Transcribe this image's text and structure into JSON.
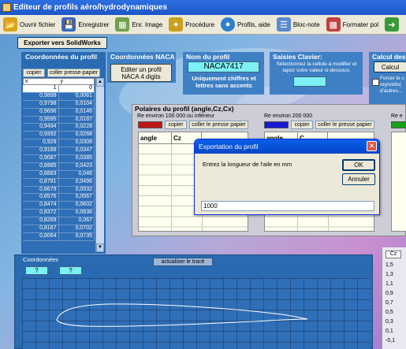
{
  "window": {
    "title": "Editeur de profils aéro/hydrodynamiques"
  },
  "toolbar": [
    {
      "label": "Ouvrir fichier",
      "icon": "folder-open-icon",
      "color": "#d8a21c"
    },
    {
      "label": "Enregistrer",
      "icon": "save-icon",
      "color": "#3a64c4"
    },
    {
      "label": "Enr. Image",
      "icon": "image-icon",
      "color": "#6fa04a"
    },
    {
      "label": "Procédure",
      "icon": "magic-wand-icon",
      "color": "#caa020"
    },
    {
      "label": "Profils, aide",
      "icon": "globe-icon",
      "color": "#2d7fd0"
    },
    {
      "label": "Bloc-note",
      "icon": "notepad-icon",
      "color": "#5a8ad0"
    },
    {
      "label": "Formater pol",
      "icon": "format-icon",
      "color": "#c04040"
    },
    {
      "label": "",
      "icon": "arrow-right-icon",
      "color": "#3a9a3a"
    }
  ],
  "export_button": "Exporter vers SolidWorks",
  "coords": {
    "title": "Coordonnées du profil",
    "copy": "copier",
    "paste": "coller presse-papier",
    "col_x": "x",
    "col_y": "y",
    "rows": [
      [
        "1",
        "0"
      ],
      [
        "0,9899",
        "0,0061"
      ],
      [
        "0,9798",
        "0,0104"
      ],
      [
        "0,9696",
        "0,0146"
      ],
      [
        "0,9595",
        "0,0187"
      ],
      [
        "0,9494",
        "0,0228"
      ],
      [
        "0,9392",
        "0,0268"
      ],
      [
        "0,929",
        "0,0308"
      ],
      [
        "0,9189",
        "0,0347"
      ],
      [
        "0,9087",
        "0,0385"
      ],
      [
        "0,8985",
        "0,0423"
      ],
      [
        "0,8883",
        "0,046"
      ],
      [
        "0,8781",
        "0,0496"
      ],
      [
        "0,8679",
        "0,0532"
      ],
      [
        "0,8576",
        "0,0567"
      ],
      [
        "0,8474",
        "0,0602"
      ],
      [
        "0,8372",
        "0,0636"
      ],
      [
        "0,8269",
        "0,067"
      ],
      [
        "0,8167",
        "0,0702"
      ],
      [
        "0,8064",
        "0,0735"
      ]
    ]
  },
  "naca": {
    "title": "Coordonnées NACA",
    "button": "Editer un  profil NACA 4 digits"
  },
  "nom": {
    "title": "Nom du profil",
    "value": "NACA7417",
    "note": "Uniquement chiffres et lettres sans accents"
  },
  "saisies": {
    "title": "Saisies Clavier:",
    "text": "Sélectionnez la cellule à modifier et tapez votre valeur  ci-dessous:"
  },
  "calcul": {
    "title": "Calcul des",
    "button": "Calcul",
    "text": "Forcer le c reynolds( d'autres..."
  },
  "polar": {
    "title": "Polaires du profil (angle,Cz,Cx)",
    "re1": "Re environ 100 000 ou inférieur",
    "re2": "Re environ 200 000",
    "re3": "Re e",
    "copy": "copier",
    "paste": "coller le presse papier",
    "col_angle": "angle",
    "col_cz": "Cz",
    "col_c": "C",
    "color1": "#c01818",
    "color2": "#1818d0",
    "color3": "#18a018"
  },
  "dialog": {
    "title": "Exportation du profil",
    "message": "Entrez la longueur de l'aile en mm",
    "ok": "OK",
    "cancel": "Annuler",
    "value": "1000"
  },
  "graph": {
    "coords_label": "Coordonnées",
    "q1": "?",
    "q2": "?",
    "refresh": "actualiser le tracé",
    "cz_label": "Cz",
    "cz_ticks": [
      "1,5",
      "1,3",
      "1,1",
      "0,9",
      "0,7",
      "0,5",
      "0,3",
      "0,1",
      "-0,1"
    ]
  }
}
